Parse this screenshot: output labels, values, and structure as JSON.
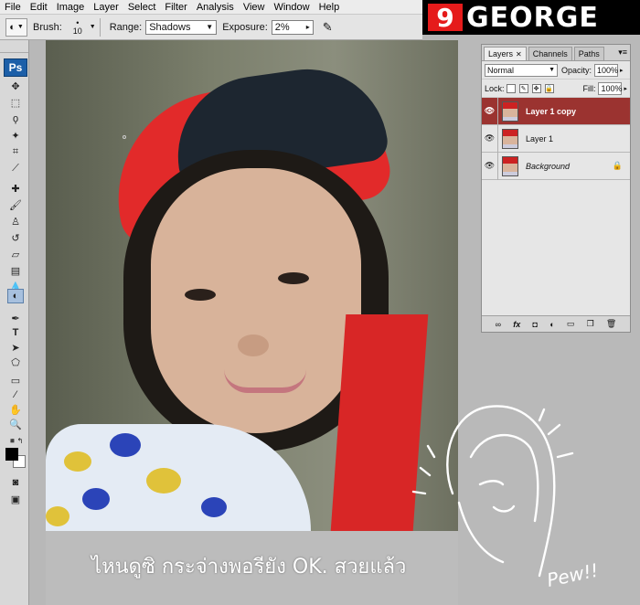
{
  "menubar": {
    "items": [
      "File",
      "Edit",
      "Image",
      "Layer",
      "Select",
      "Filter",
      "Analysis",
      "View",
      "Window",
      "Help"
    ]
  },
  "logo": {
    "digit": "9",
    "word": "GEORGE"
  },
  "options": {
    "brush_label": "Brush:",
    "brush_size": "10",
    "range_label": "Range:",
    "range_value": "Shadows",
    "exposure_label": "Exposure:",
    "exposure_value": "2%"
  },
  "toolbox": {
    "badge": "Ps"
  },
  "caption": "ไหนดูซิ กระจ่างพอรียัง OK. สวยแล้ว",
  "sketch_text": "Pew!!",
  "layers_panel": {
    "tabs": [
      {
        "label": "Layers",
        "active": true
      },
      {
        "label": "Channels",
        "active": false
      },
      {
        "label": "Paths",
        "active": false
      }
    ],
    "blend_mode": "Normal",
    "opacity_label": "Opacity:",
    "opacity_value": "100%",
    "lock_label": "Lock:",
    "fill_label": "Fill:",
    "fill_value": "100%",
    "layers": [
      {
        "name": "Layer 1 copy",
        "selected": true
      },
      {
        "name": "Layer 1",
        "selected": false
      },
      {
        "name": "Background",
        "selected": false,
        "locked": true
      }
    ],
    "footer_icons": [
      "link-icon",
      "fx-icon",
      "mask-icon",
      "adjustment-icon",
      "folder-icon",
      "new-layer-icon",
      "trash-icon"
    ]
  },
  "colors": {
    "selected_layer": "#9b3330",
    "logo_red": "#e51b1b",
    "ps_blue": "#1c5fa8"
  }
}
